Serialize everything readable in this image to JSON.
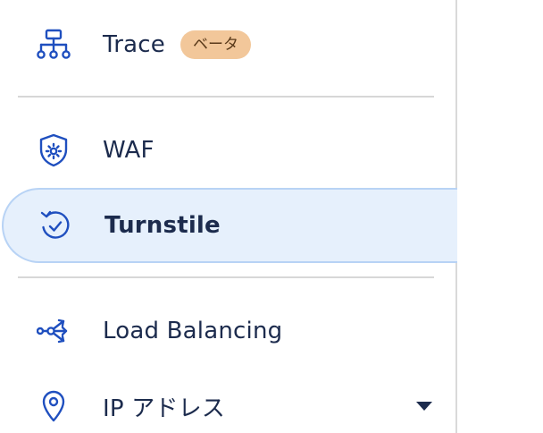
{
  "sidebar": {
    "items": [
      {
        "id": "trace",
        "label": "Trace",
        "icon": "sitemap-icon",
        "badge": "ベータ"
      },
      {
        "id": "waf",
        "label": "WAF",
        "icon": "shield-gear-icon"
      },
      {
        "id": "turnstile",
        "label": "Turnstile",
        "icon": "refresh-check-icon",
        "active": true
      },
      {
        "id": "load-balancing",
        "label": "Load Balancing",
        "icon": "load-balancer-icon"
      },
      {
        "id": "ip-addresses",
        "label": "IP アドレス",
        "icon": "map-pin-icon",
        "expandable": true
      }
    ]
  },
  "colors": {
    "icon": "#1f4fbf",
    "text": "#1c2b4d",
    "active_bg": "#e6f0fc",
    "active_border": "#b8d3f5",
    "badge_bg": "#f2c79a",
    "badge_text": "#5a3a1a",
    "divider": "#d7d7d7"
  }
}
